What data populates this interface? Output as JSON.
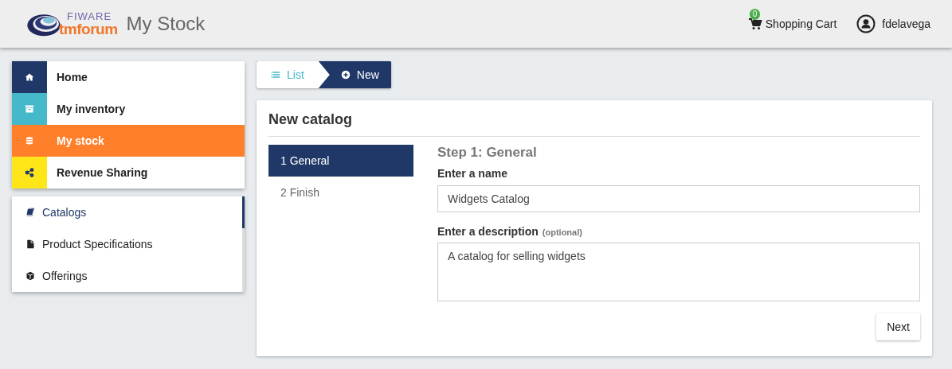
{
  "header": {
    "logo": {
      "top": "FIWARE",
      "bottom": "tmforum"
    },
    "title": "My Stock",
    "cart": {
      "count": "0",
      "label": "Shopping Cart"
    },
    "user": "fdelavega"
  },
  "main_nav": [
    {
      "label": "Home",
      "kind": "home",
      "color": "#1f3868",
      "selected": false
    },
    {
      "label": "My inventory",
      "kind": "archive",
      "color": "#45b8c9",
      "selected": false
    },
    {
      "label": "My stock",
      "kind": "database",
      "color": "#ff7f2a",
      "selected": true
    },
    {
      "label": "Revenue Sharing",
      "kind": "share",
      "color": "#ffe619",
      "selected": false
    }
  ],
  "sub_nav": [
    {
      "label": "Catalogs",
      "kind": "book",
      "selected": true
    },
    {
      "label": "Product Specifications",
      "kind": "file",
      "selected": false
    },
    {
      "label": "Offerings",
      "kind": "cube",
      "selected": false
    }
  ],
  "breadcrumb": [
    {
      "label": "List",
      "kind": "list",
      "selected": false
    },
    {
      "label": "New",
      "kind": "plus",
      "selected": true
    }
  ],
  "card": {
    "title": "New catalog",
    "steps": [
      {
        "label": "1 General",
        "selected": true
      },
      {
        "label": "2 Finish",
        "selected": false
      }
    ],
    "step_title": "Step 1: General",
    "name_label": "Enter a name",
    "name_value": "Widgets Catalog",
    "description_label": "Enter a description",
    "description_hint": "(optional)",
    "description_value": "A catalog for selling widgets",
    "next_button": "Next"
  }
}
